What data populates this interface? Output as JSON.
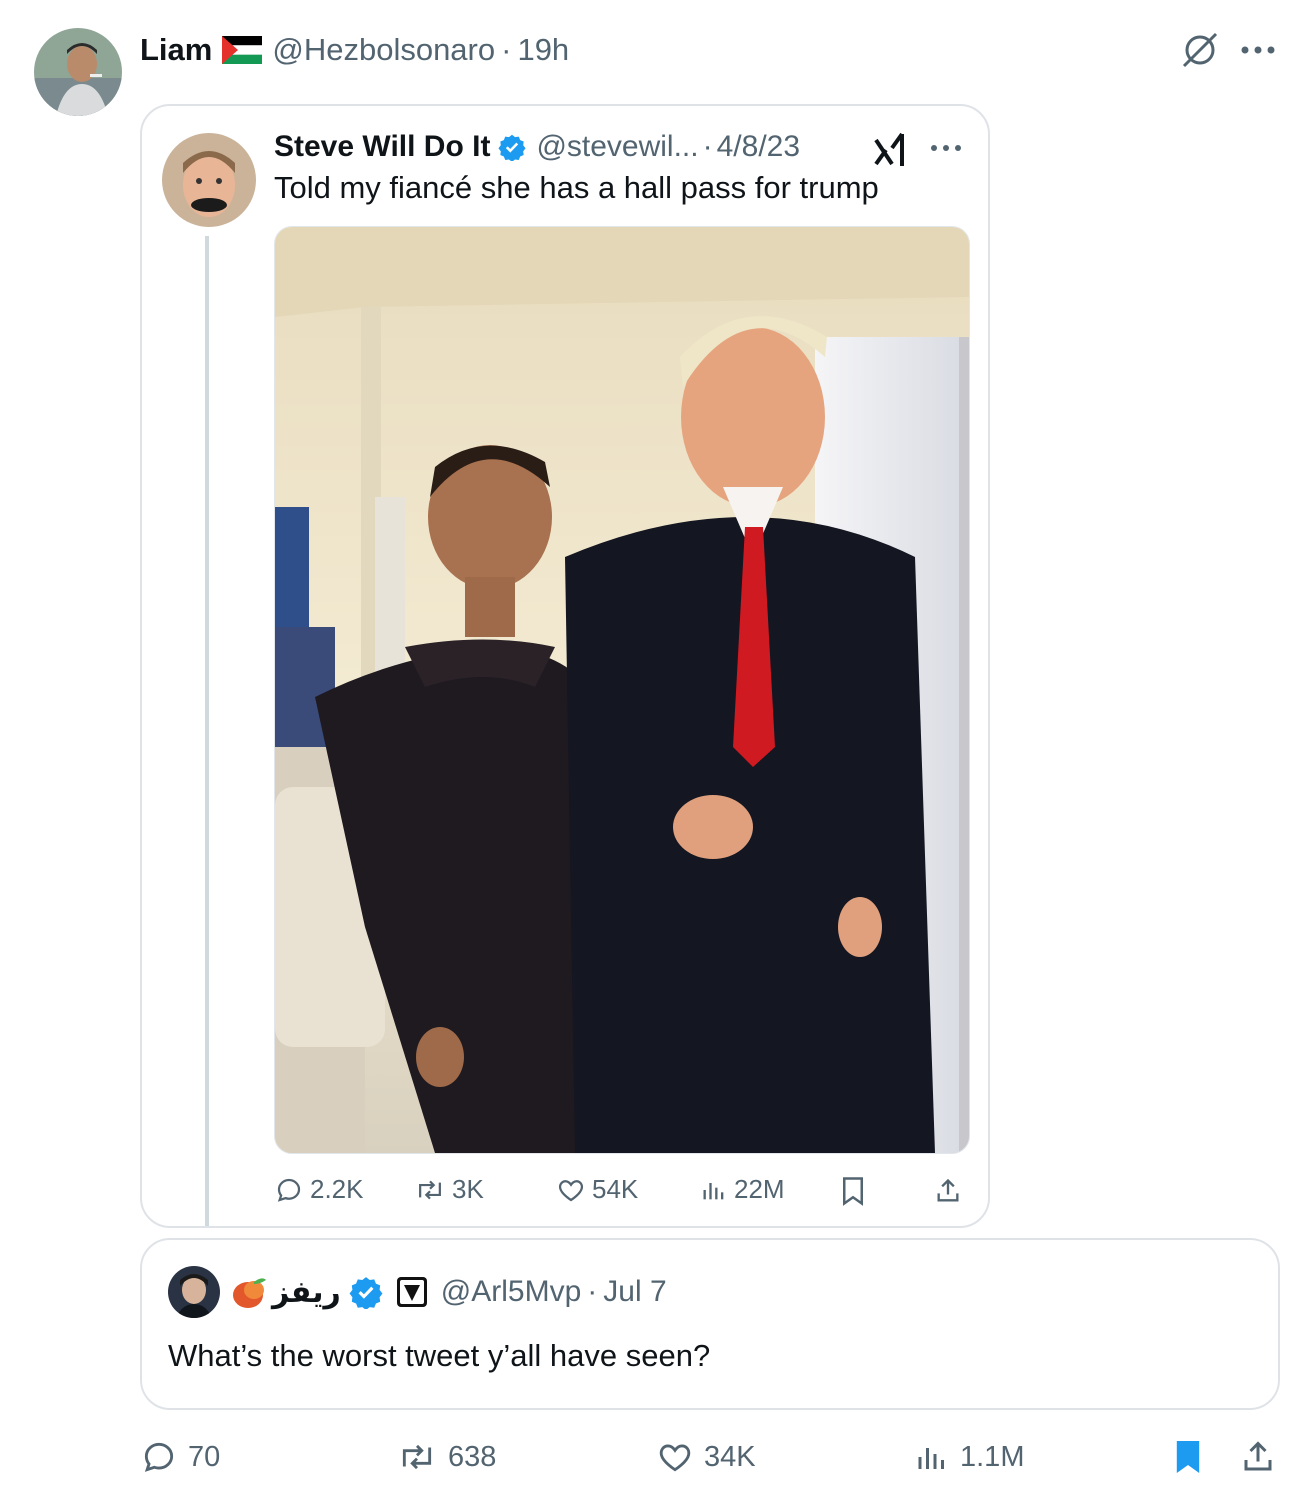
{
  "outer_tweet": {
    "display_name": "Liam",
    "handle": "@Hezbolsonaro",
    "separator": "·",
    "time": "19h",
    "flag": "palestine-flag-icon"
  },
  "quoted_card": {
    "display_name": "Steve Will Do It",
    "handle": "@stevewil...",
    "separator": "·",
    "date": "4/8/23",
    "text": "Told my fiancé she has a hall pass for trump",
    "stats": {
      "replies": "2.2K",
      "reposts": "3K",
      "likes": "54K",
      "views": "22M"
    }
  },
  "inner_quote": {
    "display_name": "ريفز",
    "handle": "@Arl5Mvp",
    "separator": "·",
    "date": "Jul 7",
    "text": "What’s the worst tweet y’all have seen?"
  },
  "outer_stats": {
    "replies": "70",
    "reposts": "638",
    "likes": "34K",
    "views": "1.1M"
  },
  "colors": {
    "verified": "#1d9bf0",
    "bookmark_active": "#1d9bf0",
    "muted": "#536471",
    "border": "#dfe3e7"
  }
}
